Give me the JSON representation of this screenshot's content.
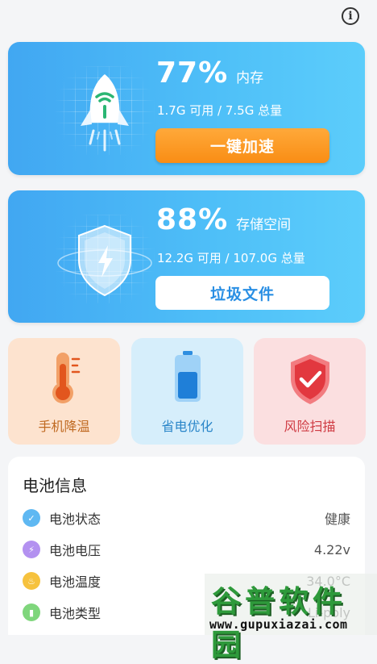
{
  "header": {
    "info_icon": "info-icon",
    "info_glyph": "i"
  },
  "memory": {
    "percent": "77%",
    "label": "内存",
    "detail": "1.7G 可用 / 7.5G 总量",
    "button": "一键加速",
    "icon": "rocket-icon",
    "usage_fraction": 0.77
  },
  "storage": {
    "percent": "88%",
    "label": "存储空间",
    "detail": "12.2G 可用 / 107.0G 总量",
    "button": "垃圾文件",
    "icon": "shield-lightning-icon",
    "usage_fraction": 0.88
  },
  "tiles": [
    {
      "label": "手机降温",
      "icon": "thermometer-icon"
    },
    {
      "label": "省电优化",
      "icon": "battery-icon"
    },
    {
      "label": "风险扫描",
      "icon": "shield-check-icon"
    }
  ],
  "battery_info": {
    "title": "电池信息",
    "rows": [
      {
        "name": "电池状态",
        "value": "健康",
        "icon": "status-icon",
        "color": "#5fb8f2"
      },
      {
        "name": "电池电压",
        "value": "4.22v",
        "icon": "lightning-icon",
        "color": "#b391f0"
      },
      {
        "name": "电池温度",
        "value": "34.0°C",
        "icon": "flame-icon",
        "color": "#f6c23e"
      },
      {
        "name": "电池类型",
        "value": "Li-poly",
        "icon": "battery-type-icon",
        "color": "#7fd67c"
      }
    ]
  },
  "watermark": {
    "title": "谷普软件园",
    "url": "www.gupuxiazai.com"
  },
  "colors": {
    "card_blue": "#41a7f2",
    "accent_orange": "#f98d14",
    "cool_tile": "#fde3cf",
    "save_tile": "#d6eefb",
    "risk_tile": "#fbdfe0"
  }
}
